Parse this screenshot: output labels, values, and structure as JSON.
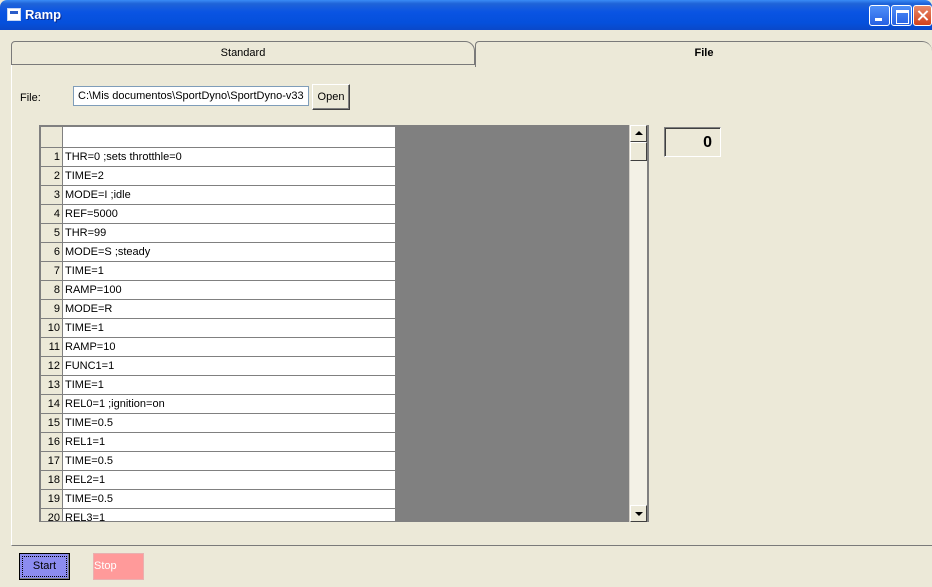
{
  "window": {
    "title": "Ramp"
  },
  "tabs": [
    {
      "label": "Standard",
      "active": false
    },
    {
      "label": "File",
      "active": true
    }
  ],
  "file": {
    "label": "File:",
    "path": "C:\\Mis documentos\\SportDyno\\SportDyno-v33",
    "open_label": "Open"
  },
  "script_lines": [
    {
      "n": "1",
      "text": "THR=0 ;sets throtthle=0"
    },
    {
      "n": "2",
      "text": "TIME=2"
    },
    {
      "n": "3",
      "text": "MODE=I ;idle"
    },
    {
      "n": "4",
      "text": "REF=5000"
    },
    {
      "n": "5",
      "text": "THR=99"
    },
    {
      "n": "6",
      "text": "MODE=S ;steady"
    },
    {
      "n": "7",
      "text": "TIME=1"
    },
    {
      "n": "8",
      "text": "RAMP=100"
    },
    {
      "n": "9",
      "text": "MODE=R"
    },
    {
      "n": "10",
      "text": "TIME=1"
    },
    {
      "n": "11",
      "text": "RAMP=10"
    },
    {
      "n": "12",
      "text": "FUNC1=1"
    },
    {
      "n": "13",
      "text": "TIME=1"
    },
    {
      "n": "14",
      "text": "REL0=1 ;ignition=on"
    },
    {
      "n": "15",
      "text": "TIME=0.5"
    },
    {
      "n": "16",
      "text": "REL1=1"
    },
    {
      "n": "17",
      "text": "TIME=0.5"
    },
    {
      "n": "18",
      "text": "REL2=1"
    },
    {
      "n": "19",
      "text": "TIME=0.5"
    },
    {
      "n": "20",
      "text": "REL3=1"
    }
  ],
  "counter": {
    "value": "0"
  },
  "controls": {
    "start_label": "Start",
    "stop_label": "Stop"
  },
  "colors": {
    "start_bg": "#8C8CF0",
    "stop_bg": "#FF9A9A",
    "title_bar": "#0A54E3"
  }
}
